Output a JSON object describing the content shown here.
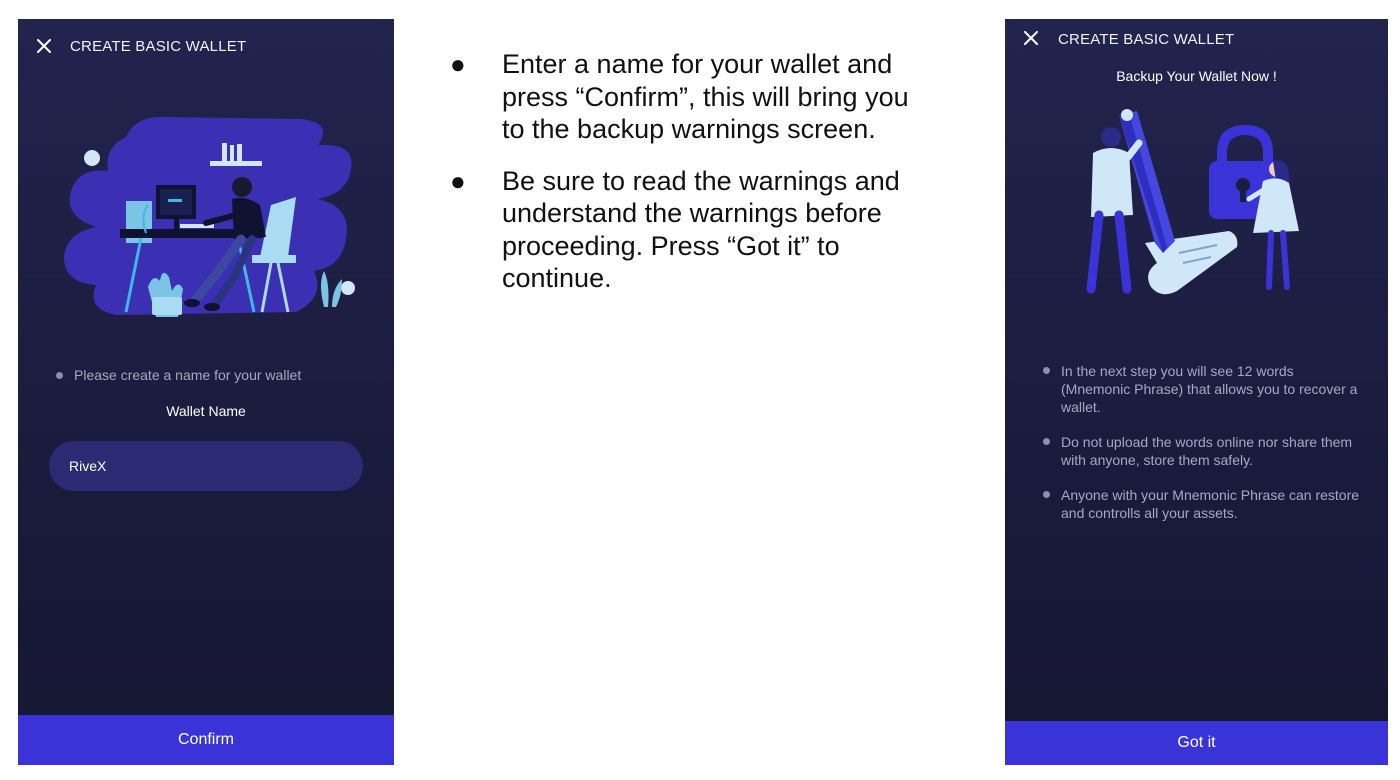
{
  "left_screen": {
    "title": "CREATE BASIC WALLET",
    "close_icon": "close-icon",
    "illustration": "person-at-computer-illustration",
    "hint": "Please create a name for your wallet",
    "field_label": "Wallet Name",
    "wallet_name_value": "RiveX",
    "confirm_label": "Confirm"
  },
  "instructions": {
    "items": [
      "Enter a name for your wallet and press “Confirm”, this will bring you to the backup warnings screen.",
      "Be sure to read the warnings and understand the warnings before proceeding. Press “Got it” to continue."
    ]
  },
  "right_screen": {
    "title": "CREATE BASIC WALLET",
    "close_icon": "close-icon",
    "subtitle": "Backup Your Wallet Now !",
    "illustration": "padlock-and-pen-illustration",
    "warnings": [
      "In the next step you will see 12 words (Mnemonic Phrase) that allows you to recover a wallet.",
      "Do not upload the words online nor share them with anyone, store them safely.",
      "Anyone with your Mnemonic Phrase can restore and controlls all your assets."
    ],
    "got_it_label": "Got it"
  },
  "colors": {
    "screen_background": "#1c1d40",
    "accent_button": "#3a34d8",
    "input_background": "#2b2b73",
    "secondary_text": "#a7a9c0"
  }
}
